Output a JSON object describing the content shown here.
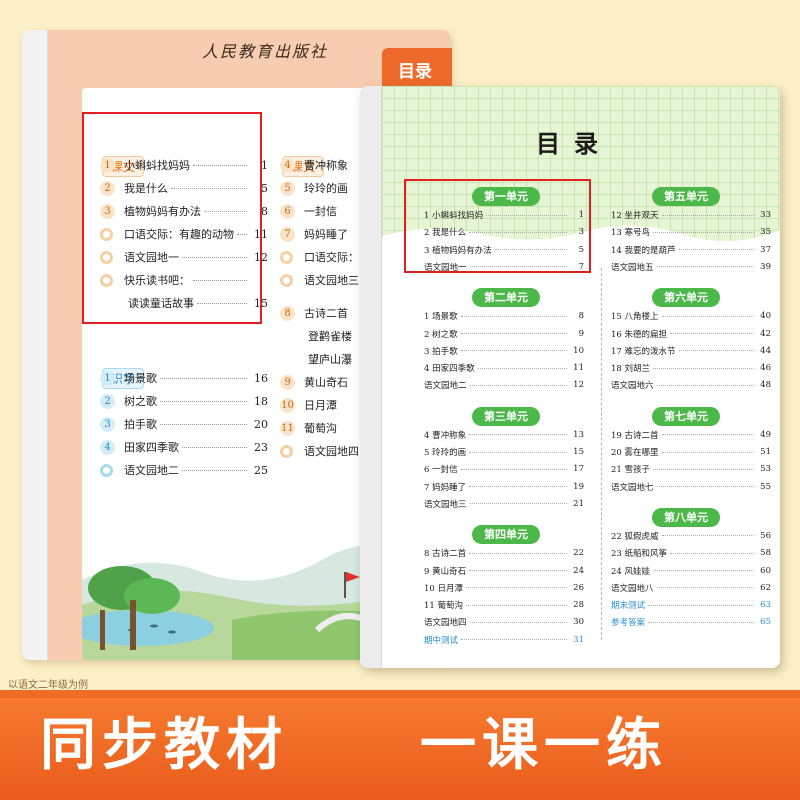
{
  "colors": {
    "accent_orange": "#f06b27",
    "green_unit": "#4cb84a",
    "highlight_red": "#e02020",
    "link_blue": "#2a8fd8"
  },
  "left_book": {
    "publisher": "人民教育出版社",
    "tab_label": "目录",
    "sections": [
      {
        "label": "课文",
        "items": [
          {
            "marker": "1",
            "title": "小蝌蚪找妈妈",
            "page": "1"
          },
          {
            "marker": "2",
            "title": "我是什么",
            "page": "5"
          },
          {
            "marker": "3",
            "title": "植物妈妈有办法",
            "page": "8"
          },
          {
            "marker": "flower",
            "title": "口语交际：有趣的动物",
            "page": "11"
          },
          {
            "marker": "flower",
            "title": "语文园地一",
            "page": "12"
          },
          {
            "marker": "flower",
            "title": "快乐读书吧：",
            "page": ""
          },
          {
            "marker": "",
            "title": "读读童话故事",
            "page": "15"
          }
        ]
      },
      {
        "label": "识字",
        "items": [
          {
            "marker": "1",
            "title": "场景歌",
            "page": "16"
          },
          {
            "marker": "2",
            "title": "树之歌",
            "page": "18"
          },
          {
            "marker": "3",
            "title": "拍手歌",
            "page": "20"
          },
          {
            "marker": "4",
            "title": "田家四季歌",
            "page": "23"
          },
          {
            "marker": "flower",
            "title": "语文园地二",
            "page": "25"
          }
        ]
      },
      {
        "label": "课文",
        "items": [
          {
            "marker": "4",
            "title": "曹冲称象",
            "page": ""
          },
          {
            "marker": "5",
            "title": "玲玲的画",
            "page": ""
          },
          {
            "marker": "6",
            "title": "一封信",
            "page": ""
          },
          {
            "marker": "7",
            "title": "妈妈睡了",
            "page": ""
          },
          {
            "marker": "flower",
            "title": "口语交际：",
            "page": ""
          },
          {
            "marker": "flower",
            "title": "语文园地三",
            "page": ""
          },
          {
            "marker": "8",
            "title": "古诗二首",
            "page": ""
          },
          {
            "marker": "",
            "title": "登鹳雀楼",
            "page": ""
          },
          {
            "marker": "",
            "title": "望庐山瀑",
            "page": ""
          },
          {
            "marker": "9",
            "title": "黄山奇石",
            "page": ""
          },
          {
            "marker": "10",
            "title": "日月潭",
            "page": ""
          },
          {
            "marker": "11",
            "title": "葡萄沟",
            "page": ""
          },
          {
            "marker": "flower",
            "title": "语文园地四",
            "page": ""
          }
        ]
      }
    ]
  },
  "right_book": {
    "title": "目录",
    "left_column": [
      {
        "unit": "第一单元",
        "items": [
          {
            "title": "1 小蝌蚪找妈妈",
            "page": "1"
          },
          {
            "title": "2 我是什么",
            "page": "3"
          },
          {
            "title": "3 植物妈妈有办法",
            "page": "5"
          },
          {
            "title": "语文园地一",
            "page": "7"
          }
        ]
      },
      {
        "unit": "第二单元",
        "items": [
          {
            "title": "1 场景歌",
            "page": "8"
          },
          {
            "title": "2 树之歌",
            "page": "9"
          },
          {
            "title": "3 拍手歌",
            "page": "10"
          },
          {
            "title": "4 田家四季歌",
            "page": "11"
          },
          {
            "title": "语文园地二",
            "page": "12"
          }
        ]
      },
      {
        "unit": "第三单元",
        "items": [
          {
            "title": "4 曹冲称象",
            "page": "13"
          },
          {
            "title": "5 玲玲的画",
            "page": "15"
          },
          {
            "title": "6 一封信",
            "page": "17"
          },
          {
            "title": "7 妈妈睡了",
            "page": "19"
          },
          {
            "title": "语文园地三",
            "page": "21"
          }
        ]
      },
      {
        "unit": "第四单元",
        "items": [
          {
            "title": "8 古诗二首",
            "page": "22"
          },
          {
            "title": "9 黄山奇石",
            "page": "24"
          },
          {
            "title": "10 日月潭",
            "page": "26"
          },
          {
            "title": "11 葡萄沟",
            "page": "28"
          },
          {
            "title": "语文园地四",
            "page": "30"
          },
          {
            "title": "期中测试",
            "page": "31",
            "blue": true
          }
        ]
      }
    ],
    "right_column": [
      {
        "unit": "第五单元",
        "items": [
          {
            "title": "12 坐井观天",
            "page": "33"
          },
          {
            "title": "13 寒号鸟",
            "page": "35"
          },
          {
            "title": "14 我要的是葫芦",
            "page": "37"
          },
          {
            "title": "语文园地五",
            "page": "39"
          }
        ]
      },
      {
        "unit": "第六单元",
        "items": [
          {
            "title": "15 八角楼上",
            "page": "40"
          },
          {
            "title": "16 朱德的扁担",
            "page": "42"
          },
          {
            "title": "17 难忘的泼水节",
            "page": "44"
          },
          {
            "title": "18 刘胡兰",
            "page": "46"
          },
          {
            "title": "语文园地六",
            "page": "48"
          }
        ]
      },
      {
        "unit": "第七单元",
        "items": [
          {
            "title": "19 古诗二首",
            "page": "49"
          },
          {
            "title": "20 雾在哪里",
            "page": "51"
          },
          {
            "title": "21 雪孩子",
            "page": "53"
          },
          {
            "title": "语文园地七",
            "page": "55"
          }
        ]
      },
      {
        "unit": "第八单元",
        "items": [
          {
            "title": "22 狐假虎威",
            "page": "56"
          },
          {
            "title": "23 纸船和风筝",
            "page": "58"
          },
          {
            "title": "24 风娃娃",
            "page": "60"
          },
          {
            "title": "语文园地八",
            "page": "62"
          },
          {
            "title": "期末测试",
            "page": "63",
            "blue": true
          },
          {
            "title": "参考答案",
            "page": "65",
            "blue": true
          }
        ]
      }
    ]
  },
  "caption": "以语文二年级为例",
  "banner": {
    "left": "同步教材",
    "right": "一课一练"
  }
}
